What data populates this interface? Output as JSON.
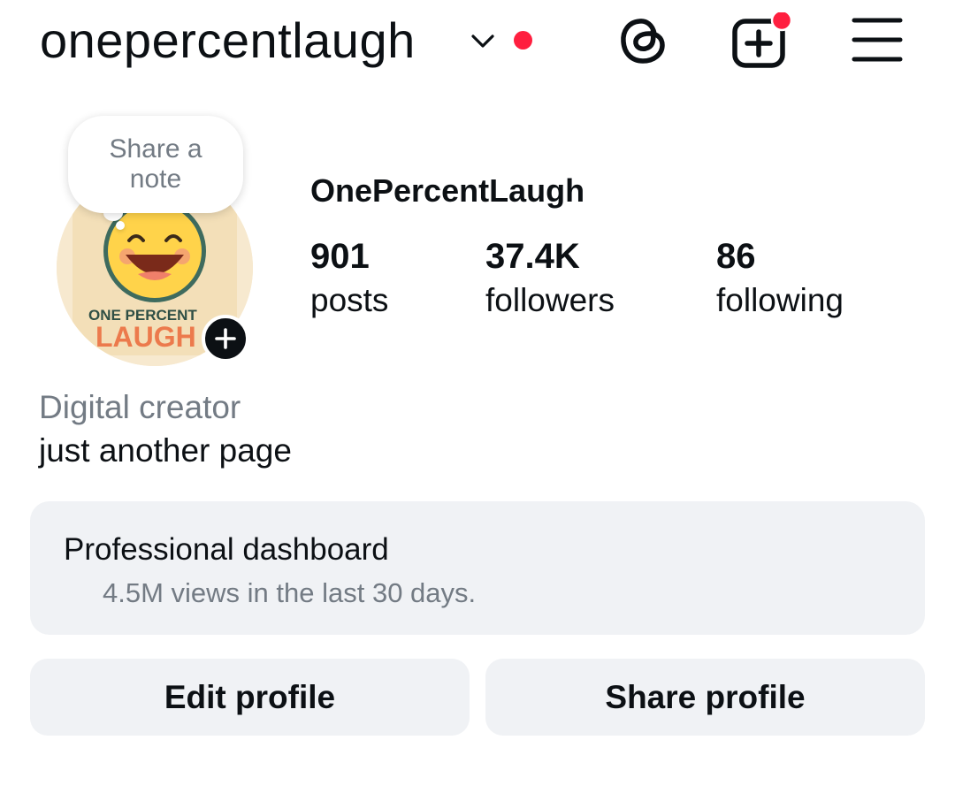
{
  "header": {
    "username": "onepercentlaugh",
    "icons": [
      "chevron-down-icon",
      "notification-dot",
      "threads-icon",
      "create-post-icon",
      "menu-icon"
    ]
  },
  "profile": {
    "note_line1": "Share a",
    "note_line2": "note",
    "display_name": "OnePercentLaugh",
    "avatar_text_top": "ONE PERCENT",
    "avatar_text_bottom": "LAUGH",
    "stats": [
      {
        "value": "901",
        "label": "posts"
      },
      {
        "value": "37.4K",
        "label": "followers"
      },
      {
        "value": "86",
        "label": "following"
      }
    ],
    "category": "Digital creator",
    "bio": "just another page"
  },
  "dashboard": {
    "title": "Professional dashboard",
    "subtitle": "4.5M views in the last 30 days."
  },
  "actions": {
    "edit_label": "Edit profile",
    "share_label": "Share profile"
  },
  "colors": {
    "text": "#0c1014",
    "muted": "#737b84",
    "surface": "#f0f2f5",
    "notification": "#ff1f3f",
    "avatar_bg": "#f7e9cf",
    "face": "#ffd34a",
    "logo_orange": "#ec7a4c"
  }
}
